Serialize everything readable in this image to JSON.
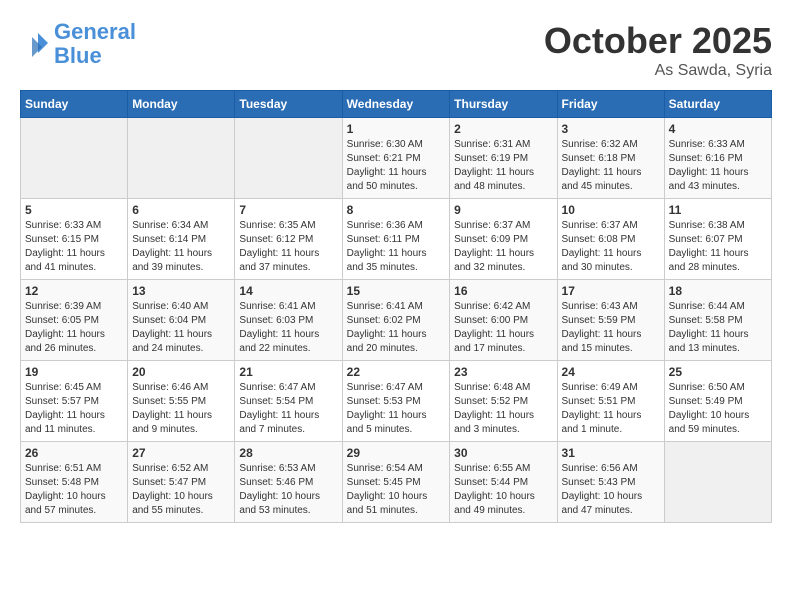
{
  "header": {
    "logo_line1": "General",
    "logo_line2": "Blue",
    "month": "October 2025",
    "location": "As Sawda, Syria"
  },
  "days_of_week": [
    "Sunday",
    "Monday",
    "Tuesday",
    "Wednesday",
    "Thursday",
    "Friday",
    "Saturday"
  ],
  "weeks": [
    [
      {
        "day": "",
        "info": ""
      },
      {
        "day": "",
        "info": ""
      },
      {
        "day": "",
        "info": ""
      },
      {
        "day": "1",
        "info": "Sunrise: 6:30 AM\nSunset: 6:21 PM\nDaylight: 11 hours\nand 50 minutes."
      },
      {
        "day": "2",
        "info": "Sunrise: 6:31 AM\nSunset: 6:19 PM\nDaylight: 11 hours\nand 48 minutes."
      },
      {
        "day": "3",
        "info": "Sunrise: 6:32 AM\nSunset: 6:18 PM\nDaylight: 11 hours\nand 45 minutes."
      },
      {
        "day": "4",
        "info": "Sunrise: 6:33 AM\nSunset: 6:16 PM\nDaylight: 11 hours\nand 43 minutes."
      }
    ],
    [
      {
        "day": "5",
        "info": "Sunrise: 6:33 AM\nSunset: 6:15 PM\nDaylight: 11 hours\nand 41 minutes."
      },
      {
        "day": "6",
        "info": "Sunrise: 6:34 AM\nSunset: 6:14 PM\nDaylight: 11 hours\nand 39 minutes."
      },
      {
        "day": "7",
        "info": "Sunrise: 6:35 AM\nSunset: 6:12 PM\nDaylight: 11 hours\nand 37 minutes."
      },
      {
        "day": "8",
        "info": "Sunrise: 6:36 AM\nSunset: 6:11 PM\nDaylight: 11 hours\nand 35 minutes."
      },
      {
        "day": "9",
        "info": "Sunrise: 6:37 AM\nSunset: 6:09 PM\nDaylight: 11 hours\nand 32 minutes."
      },
      {
        "day": "10",
        "info": "Sunrise: 6:37 AM\nSunset: 6:08 PM\nDaylight: 11 hours\nand 30 minutes."
      },
      {
        "day": "11",
        "info": "Sunrise: 6:38 AM\nSunset: 6:07 PM\nDaylight: 11 hours\nand 28 minutes."
      }
    ],
    [
      {
        "day": "12",
        "info": "Sunrise: 6:39 AM\nSunset: 6:05 PM\nDaylight: 11 hours\nand 26 minutes."
      },
      {
        "day": "13",
        "info": "Sunrise: 6:40 AM\nSunset: 6:04 PM\nDaylight: 11 hours\nand 24 minutes."
      },
      {
        "day": "14",
        "info": "Sunrise: 6:41 AM\nSunset: 6:03 PM\nDaylight: 11 hours\nand 22 minutes."
      },
      {
        "day": "15",
        "info": "Sunrise: 6:41 AM\nSunset: 6:02 PM\nDaylight: 11 hours\nand 20 minutes."
      },
      {
        "day": "16",
        "info": "Sunrise: 6:42 AM\nSunset: 6:00 PM\nDaylight: 11 hours\nand 17 minutes."
      },
      {
        "day": "17",
        "info": "Sunrise: 6:43 AM\nSunset: 5:59 PM\nDaylight: 11 hours\nand 15 minutes."
      },
      {
        "day": "18",
        "info": "Sunrise: 6:44 AM\nSunset: 5:58 PM\nDaylight: 11 hours\nand 13 minutes."
      }
    ],
    [
      {
        "day": "19",
        "info": "Sunrise: 6:45 AM\nSunset: 5:57 PM\nDaylight: 11 hours\nand 11 minutes."
      },
      {
        "day": "20",
        "info": "Sunrise: 6:46 AM\nSunset: 5:55 PM\nDaylight: 11 hours\nand 9 minutes."
      },
      {
        "day": "21",
        "info": "Sunrise: 6:47 AM\nSunset: 5:54 PM\nDaylight: 11 hours\nand 7 minutes."
      },
      {
        "day": "22",
        "info": "Sunrise: 6:47 AM\nSunset: 5:53 PM\nDaylight: 11 hours\nand 5 minutes."
      },
      {
        "day": "23",
        "info": "Sunrise: 6:48 AM\nSunset: 5:52 PM\nDaylight: 11 hours\nand 3 minutes."
      },
      {
        "day": "24",
        "info": "Sunrise: 6:49 AM\nSunset: 5:51 PM\nDaylight: 11 hours\nand 1 minute."
      },
      {
        "day": "25",
        "info": "Sunrise: 6:50 AM\nSunset: 5:49 PM\nDaylight: 10 hours\nand 59 minutes."
      }
    ],
    [
      {
        "day": "26",
        "info": "Sunrise: 6:51 AM\nSunset: 5:48 PM\nDaylight: 10 hours\nand 57 minutes."
      },
      {
        "day": "27",
        "info": "Sunrise: 6:52 AM\nSunset: 5:47 PM\nDaylight: 10 hours\nand 55 minutes."
      },
      {
        "day": "28",
        "info": "Sunrise: 6:53 AM\nSunset: 5:46 PM\nDaylight: 10 hours\nand 53 minutes."
      },
      {
        "day": "29",
        "info": "Sunrise: 6:54 AM\nSunset: 5:45 PM\nDaylight: 10 hours\nand 51 minutes."
      },
      {
        "day": "30",
        "info": "Sunrise: 6:55 AM\nSunset: 5:44 PM\nDaylight: 10 hours\nand 49 minutes."
      },
      {
        "day": "31",
        "info": "Sunrise: 6:56 AM\nSunset: 5:43 PM\nDaylight: 10 hours\nand 47 minutes."
      },
      {
        "day": "",
        "info": ""
      }
    ]
  ]
}
